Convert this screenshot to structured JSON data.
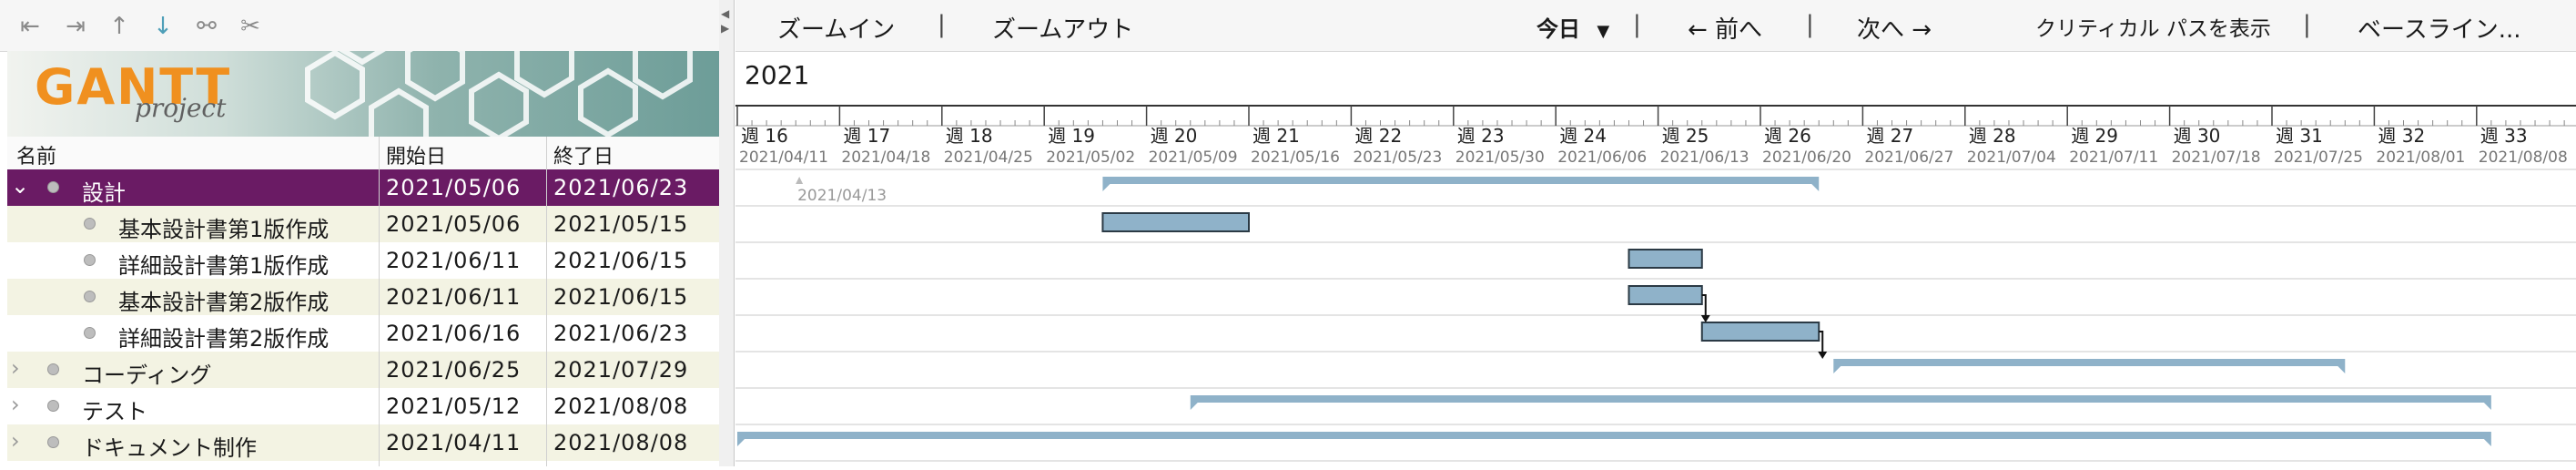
{
  "left_toolbar": {
    "icons": [
      "outdent-icon",
      "indent-icon",
      "move-up-icon",
      "move-down-icon",
      "link-icon",
      "unlink-icon"
    ]
  },
  "logo": {
    "title": "GANTT",
    "subtitle": "project"
  },
  "columns": {
    "name": "名前",
    "start": "開始日",
    "end": "終了日"
  },
  "toolbar": {
    "zoom_in": "ズームイン",
    "separator": "|",
    "zoom_out": "ズームアウト",
    "today": "今日",
    "prev": "← 前へ",
    "next": "次へ →",
    "critical_path": "クリティカル パスを表示",
    "baseline": "ベースライン..."
  },
  "year": "2021",
  "weeks": [
    {
      "label": "週 16",
      "date": "2021/04/11"
    },
    {
      "label": "週 17",
      "date": "2021/04/18"
    },
    {
      "label": "週 18",
      "date": "2021/04/25"
    },
    {
      "label": "週 19",
      "date": "2021/05/02"
    },
    {
      "label": "週 20",
      "date": "2021/05/09"
    },
    {
      "label": "週 21",
      "date": "2021/05/16"
    },
    {
      "label": "週 22",
      "date": "2021/05/23"
    },
    {
      "label": "週 23",
      "date": "2021/05/30"
    },
    {
      "label": "週 24",
      "date": "2021/06/06"
    },
    {
      "label": "週 25",
      "date": "2021/06/13"
    },
    {
      "label": "週 26",
      "date": "2021/06/20"
    },
    {
      "label": "週 27",
      "date": "2021/06/27"
    },
    {
      "label": "週 28",
      "date": "2021/07/04"
    },
    {
      "label": "週 29",
      "date": "2021/07/11"
    },
    {
      "label": "週 30",
      "date": "2021/07/18"
    },
    {
      "label": "週 31",
      "date": "2021/07/25"
    },
    {
      "label": "週 32",
      "date": "2021/08/01"
    },
    {
      "label": "週 33",
      "date": "2021/08/08"
    }
  ],
  "today_marker": "2021/04/13",
  "tasks": [
    {
      "name": "設計",
      "start": "2021/05/06",
      "end": "2021/06/23",
      "level": 0,
      "expanded": true,
      "selected": true,
      "summary": true
    },
    {
      "name": "基本設計書第1版作成",
      "start": "2021/05/06",
      "end": "2021/05/15",
      "level": 1,
      "summary": false
    },
    {
      "name": "詳細設計書第1版作成",
      "start": "2021/06/11",
      "end": "2021/06/15",
      "level": 1,
      "summary": false
    },
    {
      "name": "基本設計書第2版作成",
      "start": "2021/06/11",
      "end": "2021/06/15",
      "level": 1,
      "summary": false
    },
    {
      "name": "詳細設計書第2版作成",
      "start": "2021/06/16",
      "end": "2021/06/23",
      "level": 1,
      "summary": false
    },
    {
      "name": "コーディング",
      "start": "2021/06/25",
      "end": "2021/07/29",
      "level": 0,
      "expanded": false,
      "summary": true
    },
    {
      "name": "テスト",
      "start": "2021/05/12",
      "end": "2021/08/08",
      "level": 0,
      "expanded": false,
      "summary": true
    },
    {
      "name": "ドキュメント制作",
      "start": "2021/04/11",
      "end": "2021/08/08",
      "level": 0,
      "expanded": false,
      "summary": true
    }
  ],
  "colors": {
    "selected_row": "#6a1b64",
    "task_bar": "#8fb2c9",
    "bar_border": "#2b3a45",
    "alt_row": "#f3f3e3",
    "logo_orange": "#f0901f"
  }
}
